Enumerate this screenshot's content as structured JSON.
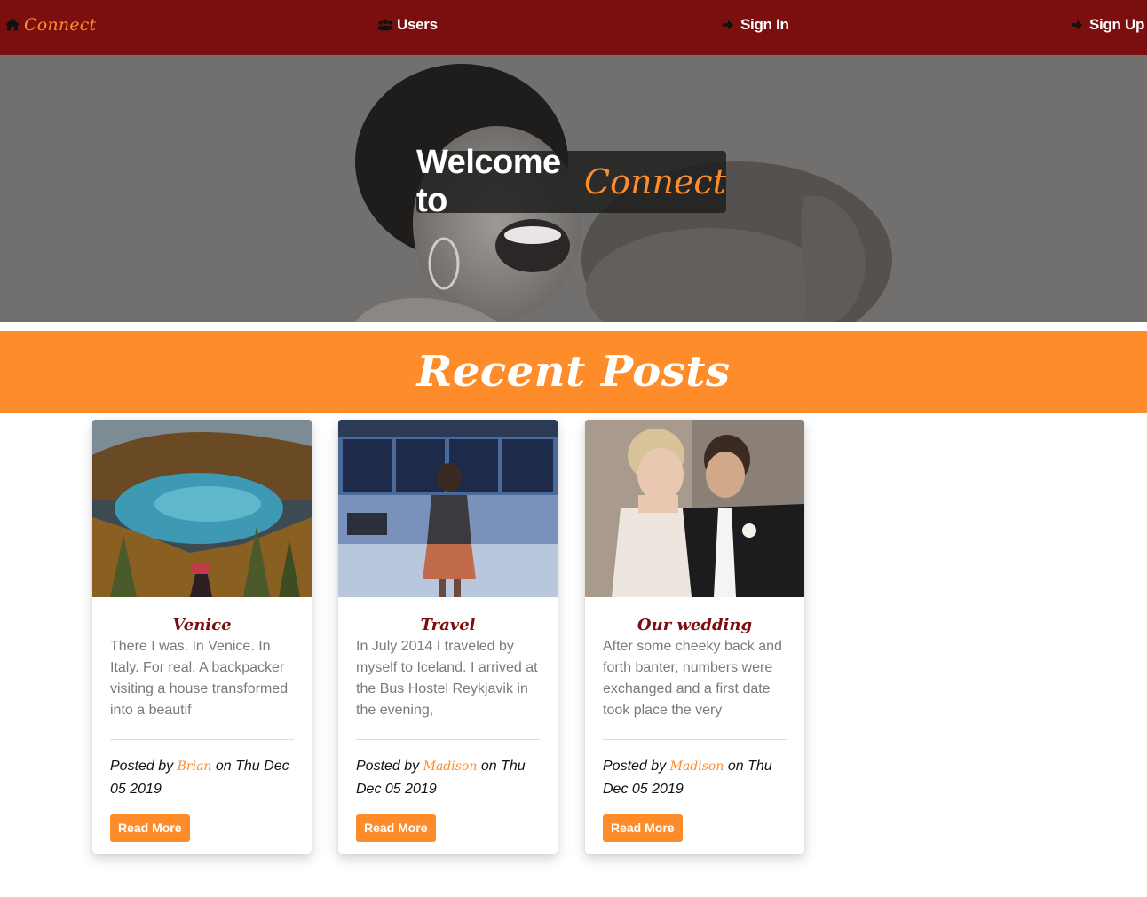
{
  "nav": {
    "brand": "Connect",
    "brand_icon": "home-icon",
    "users_label": "Users",
    "users_icon": "users-icon",
    "signin_label": "Sign In",
    "signin_icon": "sign-in-icon",
    "signup_label": "Sign Up",
    "signup_icon": "sign-in-icon"
  },
  "hero": {
    "title_prefix": "Welcome to",
    "title_brand": "Connect"
  },
  "recent": {
    "heading": "Recent Posts"
  },
  "posts": [
    {
      "title": "Venice",
      "excerpt": "There I was. In Venice. In Italy. For real. A backpacker visiting a house transformed into a beautif",
      "posted_by": "Posted by",
      "author": "Brian",
      "date": "on Thu Dec 05 2019",
      "button": "Read More"
    },
    {
      "title": "Travel",
      "excerpt": "In July 2014 I traveled by myself to Iceland. I arrived at the Bus Hostel Reykjavik in the evening,",
      "posted_by": "Posted by",
      "author": "Madison",
      "date": "on Thu Dec 05 2019",
      "button": "Read More"
    },
    {
      "title": "Our wedding",
      "excerpt": "After some cheeky back and forth banter, numbers were exchanged and a first date took place the very",
      "posted_by": "Posted by",
      "author": "Madison",
      "date": "on Thu Dec 05 2019",
      "button": "Read More"
    }
  ],
  "colors": {
    "navbar": "#7b0f0f",
    "accent": "#ff8c2b",
    "card_title": "#7b0f0f",
    "muted_text": "#7a7a7a"
  }
}
